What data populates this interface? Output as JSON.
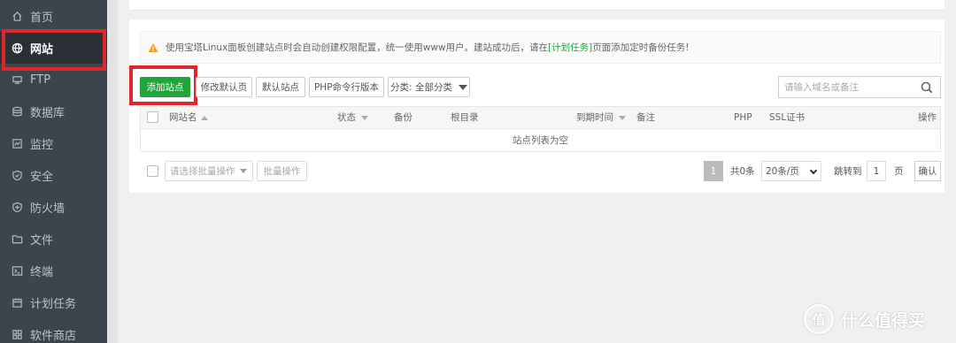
{
  "sidebar": {
    "items": [
      {
        "label": "首页",
        "icon": "home-icon"
      },
      {
        "label": "网站",
        "icon": "globe-icon",
        "active": true
      },
      {
        "label": "FTP",
        "icon": "ftp-icon"
      },
      {
        "label": "数据库",
        "icon": "database-icon"
      },
      {
        "label": "监控",
        "icon": "monitor-icon"
      },
      {
        "label": "安全",
        "icon": "shield-icon"
      },
      {
        "label": "防火墙",
        "icon": "firewall-icon"
      },
      {
        "label": "文件",
        "icon": "folder-icon"
      },
      {
        "label": "终端",
        "icon": "terminal-icon"
      },
      {
        "label": "计划任务",
        "icon": "calendar-icon"
      },
      {
        "label": "软件商店",
        "icon": "store-icon"
      }
    ]
  },
  "notice": {
    "text_before": "使用宝塔Linux面板创建站点时会自动创建权限配置，统一使用www用户。建站成功后，请在",
    "link": "[计划任务]",
    "text_after": "页面添加定时备份任务!"
  },
  "toolbar": {
    "add_site": "添加站点",
    "edit_default_page": "修改默认页",
    "default_site": "默认站点",
    "php_cli_version": "PHP命令行版本",
    "category_filter": "分类: 全部分类"
  },
  "search": {
    "placeholder": "请输入域名或备注"
  },
  "table": {
    "columns": [
      "网站名",
      "状态",
      "备份",
      "根目录",
      "到期时间",
      "备注",
      "PHP",
      "SSL证书",
      "操作"
    ],
    "empty_text": "站点列表为空"
  },
  "footer": {
    "batch_placeholder": "请选择批量操作",
    "batch_button": "批量操作",
    "current_page": "1",
    "total": "共0条",
    "per_page": "20条/页",
    "jump_label": "跳转到",
    "jump_value": "1",
    "page_unit": "页",
    "confirm": "确认"
  },
  "watermark": {
    "logo": "值",
    "text": "什么值得买"
  },
  "colors": {
    "sidebar_bg": "#3c444d",
    "accent_green": "#20a53a",
    "highlight_red": "#e0262a"
  }
}
